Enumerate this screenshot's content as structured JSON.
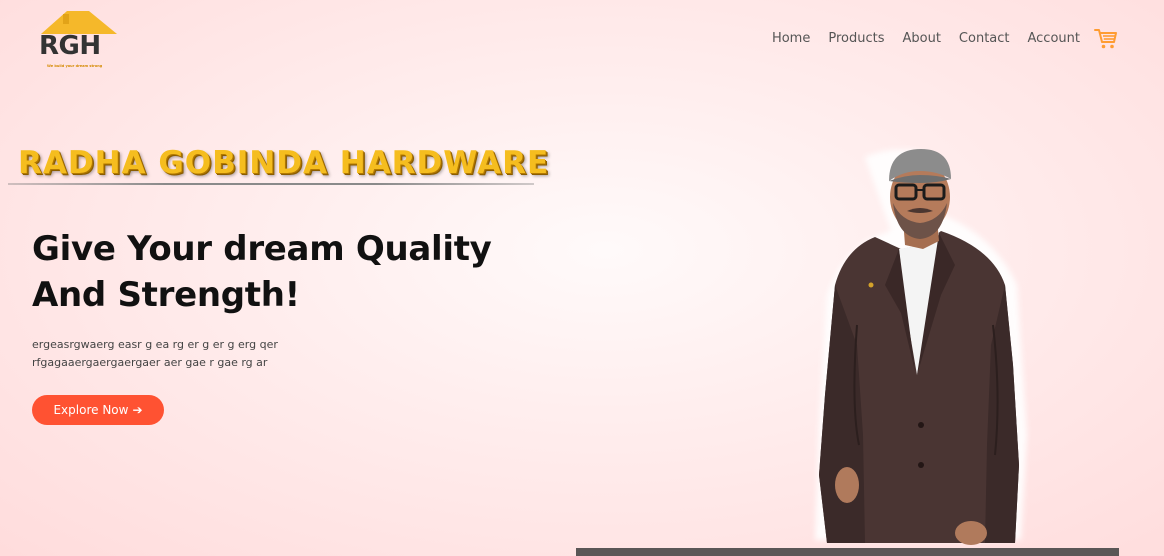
{
  "logo": {
    "text": "RGH",
    "tagline": "We build your dream strong"
  },
  "nav": {
    "items": [
      "Home",
      "Products",
      "About",
      "Contact",
      "Account"
    ],
    "cart_icon": "shopping-cart-icon"
  },
  "hero": {
    "brand": "RADHA GOBINDA HARDWARE",
    "headline_line1": "Give Your dream Quality",
    "headline_line2": "And Strength!",
    "desc_line1": "ergeasrgwaerg easr g ea rg er g er g erg qer",
    "desc_line2": "rfgagaaergaergaergaer aer gae r gae rg ar",
    "cta_label": "Explore Now",
    "cta_arrow": "➔",
    "photo": "person-in-suit-portrait"
  },
  "colors": {
    "accent": "#ff5232",
    "brand_gold": "#f5bd1f",
    "cart_orange": "#ff9c32",
    "background": "#ffdcdc"
  }
}
